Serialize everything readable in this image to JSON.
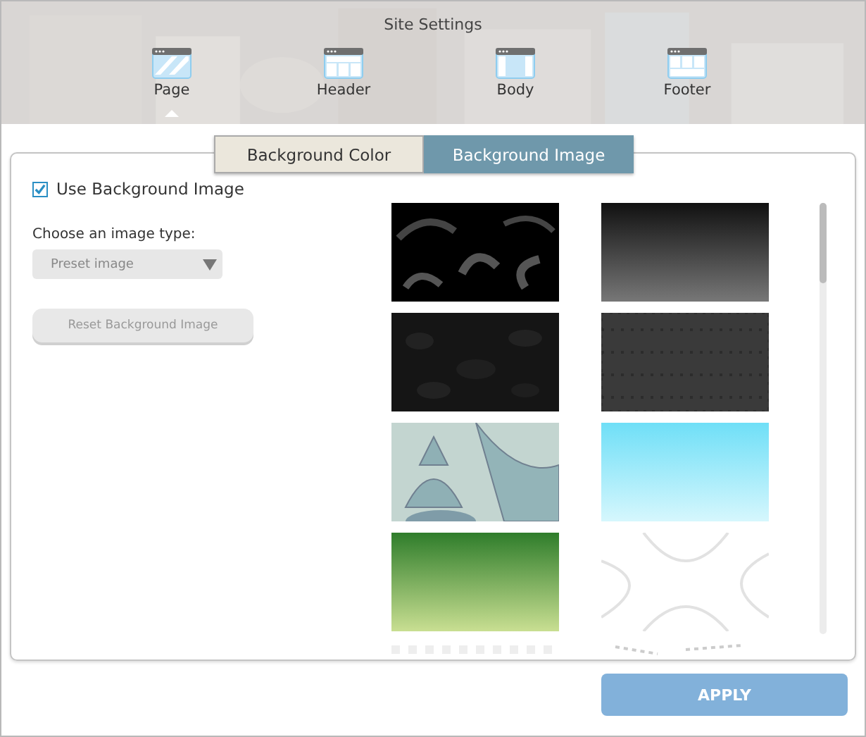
{
  "window": {
    "title": "Site Settings"
  },
  "sections": [
    {
      "label": "Page",
      "kind": "page",
      "selected": true
    },
    {
      "label": "Header",
      "kind": "header",
      "selected": false
    },
    {
      "label": "Body",
      "kind": "body",
      "selected": false
    },
    {
      "label": "Footer",
      "kind": "footer",
      "selected": false
    }
  ],
  "tabs": [
    {
      "label": "Background Color",
      "selected": false
    },
    {
      "label": "Background Image",
      "selected": true
    }
  ],
  "use_image": {
    "label": "Use Background Image",
    "checked": true
  },
  "image_type": {
    "label": "Choose an image type:",
    "value": "Preset image"
  },
  "reset_button": {
    "label": "Reset Background Image",
    "disabled": true
  },
  "apply_button": {
    "label": "APPLY"
  }
}
